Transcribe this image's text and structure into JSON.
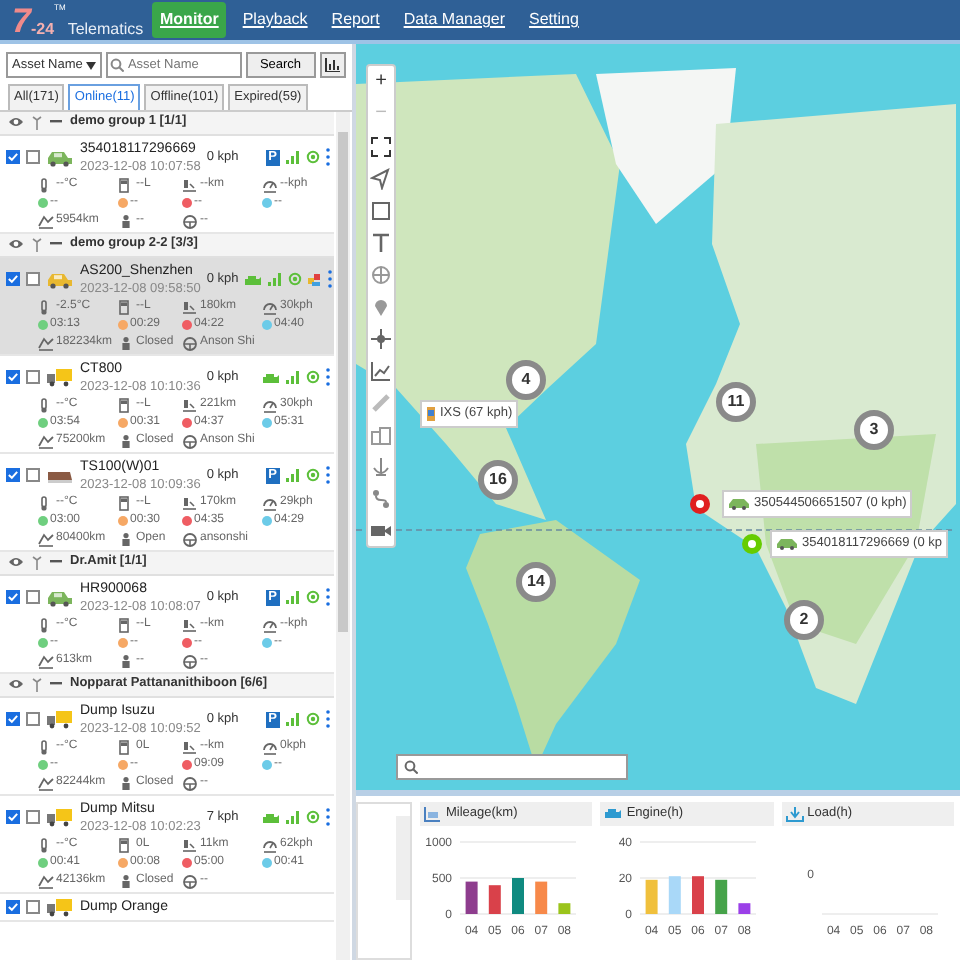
{
  "app": {
    "logo_mark": "7",
    "logo_digits": "-24",
    "logo_tm": "TM",
    "logo_text": "Telematics"
  },
  "nav": [
    {
      "label": "Monitor",
      "selected": true
    },
    {
      "label": "Playback",
      "selected": false
    },
    {
      "label": "Report",
      "selected": false
    },
    {
      "label": "Data Manager",
      "selected": false
    },
    {
      "label": "Setting",
      "selected": false
    }
  ],
  "search": {
    "field_select": "Asset Name",
    "placeholder": "Asset Name",
    "button": "Search"
  },
  "tabs": [
    {
      "label": "All(171)",
      "selected": false
    },
    {
      "label": "Online(11)",
      "selected": true
    },
    {
      "label": "Offline(101)",
      "selected": false
    },
    {
      "label": "Expired(59)",
      "selected": false
    }
  ],
  "groups": [
    {
      "name": "demo group 1 [1/1]",
      "vehicles": [
        {
          "name": "354018117296669",
          "time": "2023-12-08 10:07:58",
          "speed": "0 kph",
          "kind": "car",
          "color": "#7cb55c",
          "checked": true,
          "tracked": false,
          "selected": false,
          "status": {
            "kind": "parked",
            "label": "P"
          },
          "alert": false,
          "temp": "--°C",
          "fuel": "--L",
          "distance": "--km",
          "max_speed": "--kph",
          "timers": [
            "--",
            "--",
            "--",
            "--"
          ],
          "odometer": "5954km",
          "door": "--",
          "driver": "--"
        }
      ]
    },
    {
      "name": "demo group 2-2 [3/3]",
      "vehicles": [
        {
          "name": "AS200_Shenzhen",
          "time": "2023-12-08 09:58:50",
          "speed": "0 kph",
          "kind": "car",
          "color": "#e8b830",
          "checked": true,
          "tracked": false,
          "selected": true,
          "status": {
            "kind": "engine"
          },
          "alert": true,
          "temp": "-2.5°C",
          "fuel": "--L",
          "distance": "180km",
          "max_speed": "30kph",
          "timers": [
            "03:13",
            "00:29",
            "04:22",
            "04:40"
          ],
          "odometer": "182234km",
          "door": "Closed",
          "driver": "Anson Shi"
        },
        {
          "name": "CT800",
          "time": "2023-12-08 10:10:36",
          "speed": "0 kph",
          "kind": "truck",
          "color": "#f5c518",
          "checked": true,
          "tracked": false,
          "selected": false,
          "status": {
            "kind": "engine"
          },
          "alert": false,
          "temp": "--°C",
          "fuel": "--L",
          "distance": "221km",
          "max_speed": "30kph",
          "timers": [
            "03:54",
            "00:31",
            "04:37",
            "05:31"
          ],
          "odometer": "75200km",
          "door": "Closed",
          "driver": "Anson Shi"
        },
        {
          "name": "TS100(W)01",
          "time": "2023-12-08 10:09:36",
          "speed": "0 kph",
          "kind": "van",
          "color": "#8a5a44",
          "checked": true,
          "tracked": false,
          "selected": false,
          "status": {
            "kind": "parked",
            "label": "P"
          },
          "alert": false,
          "temp": "--°C",
          "fuel": "--L",
          "distance": "170km",
          "max_speed": "29kph",
          "timers": [
            "03:00",
            "00:30",
            "04:35",
            "04:29"
          ],
          "odometer": "80400km",
          "door": "Open",
          "driver": "ansonshi"
        }
      ]
    },
    {
      "name": "Dr.Amit [1/1]",
      "vehicles": [
        {
          "name": "HR900068",
          "time": "2023-12-08 10:08:07",
          "speed": "0 kph",
          "kind": "car",
          "color": "#7cb55c",
          "checked": true,
          "tracked": false,
          "selected": false,
          "status": {
            "kind": "parked",
            "label": "P"
          },
          "alert": false,
          "temp": "--°C",
          "fuel": "--L",
          "distance": "--km",
          "max_speed": "--kph",
          "timers": [
            "--",
            "--",
            "--",
            "--"
          ],
          "odometer": "613km",
          "door": "--",
          "driver": "--"
        }
      ]
    },
    {
      "name": "Nopparat Pattananithiboon [6/6]",
      "vehicles": [
        {
          "name": "Dump Isuzu",
          "time": "2023-12-08 10:09:52",
          "speed": "0 kph",
          "kind": "truck",
          "color": "#f5c518",
          "checked": true,
          "tracked": false,
          "selected": false,
          "status": {
            "kind": "parked",
            "label": "P"
          },
          "alert": false,
          "temp": "--°C",
          "fuel": "0L",
          "distance": "--km",
          "max_speed": "0kph",
          "timers": [
            "--",
            "--",
            "09:09",
            "--"
          ],
          "odometer": "82244km",
          "door": "Closed",
          "driver": "--"
        },
        {
          "name": "Dump Mitsu",
          "time": "2023-12-08 10:02:23",
          "speed": "7 kph",
          "kind": "truck",
          "color": "#f5c518",
          "checked": true,
          "tracked": false,
          "selected": false,
          "status": {
            "kind": "engine"
          },
          "alert": false,
          "temp": "--°C",
          "fuel": "0L",
          "distance": "11km",
          "max_speed": "62kph",
          "timers": [
            "00:41",
            "00:08",
            "05:00",
            "00:41"
          ],
          "odometer": "42136km",
          "door": "Closed",
          "driver": "--"
        },
        {
          "name": "Dump Orange",
          "kind": "truck",
          "color": "#f5c518",
          "checked": true,
          "tracked": false,
          "selected": false
        }
      ]
    }
  ],
  "map": {
    "zoom_in": "+",
    "zoom_out": "−",
    "clusters": [
      {
        "count": "4"
      },
      {
        "count": "11"
      },
      {
        "count": "3"
      },
      {
        "count": "16"
      },
      {
        "count": "14"
      },
      {
        "count": "2"
      }
    ],
    "markers": [
      {
        "label": "IXS (67 kph)",
        "kind": "device"
      },
      {
        "label": "350544506651507 (0 kph)",
        "kind": "car",
        "color": "#e02020"
      },
      {
        "label": "354018117296669 (0 kp",
        "kind": "car",
        "color": "#66cc00"
      }
    ]
  },
  "charts": [
    {
      "title": "Mileage(km)",
      "chart_data": {
        "type": "bar",
        "categories": [
          "04",
          "05",
          "06",
          "07",
          "08"
        ],
        "yticks": [
          0,
          500,
          1000
        ],
        "ylim": [
          0,
          1000
        ],
        "values": [
          450,
          400,
          500,
          450,
          150
        ],
        "colors": [
          "#8e3d8e",
          "#d9414a",
          "#0f8a80",
          "#f7894a",
          "#9bc41c"
        ]
      }
    },
    {
      "title": "Engine(h)",
      "chart_data": {
        "type": "bar",
        "categories": [
          "04",
          "05",
          "06",
          "07",
          "08"
        ],
        "yticks": [
          0,
          20,
          40
        ],
        "ylim": [
          0,
          40
        ],
        "values": [
          19,
          21,
          21,
          19,
          6
        ],
        "colors": [
          "#f0c03c",
          "#a9d8f8",
          "#d9414a",
          "#46a34a",
          "#9b40e8"
        ]
      }
    },
    {
      "title": "Load(h)",
      "axis_label": "0",
      "x_labels": [
        "04",
        "05",
        "06",
        "07",
        "08"
      ]
    }
  ]
}
